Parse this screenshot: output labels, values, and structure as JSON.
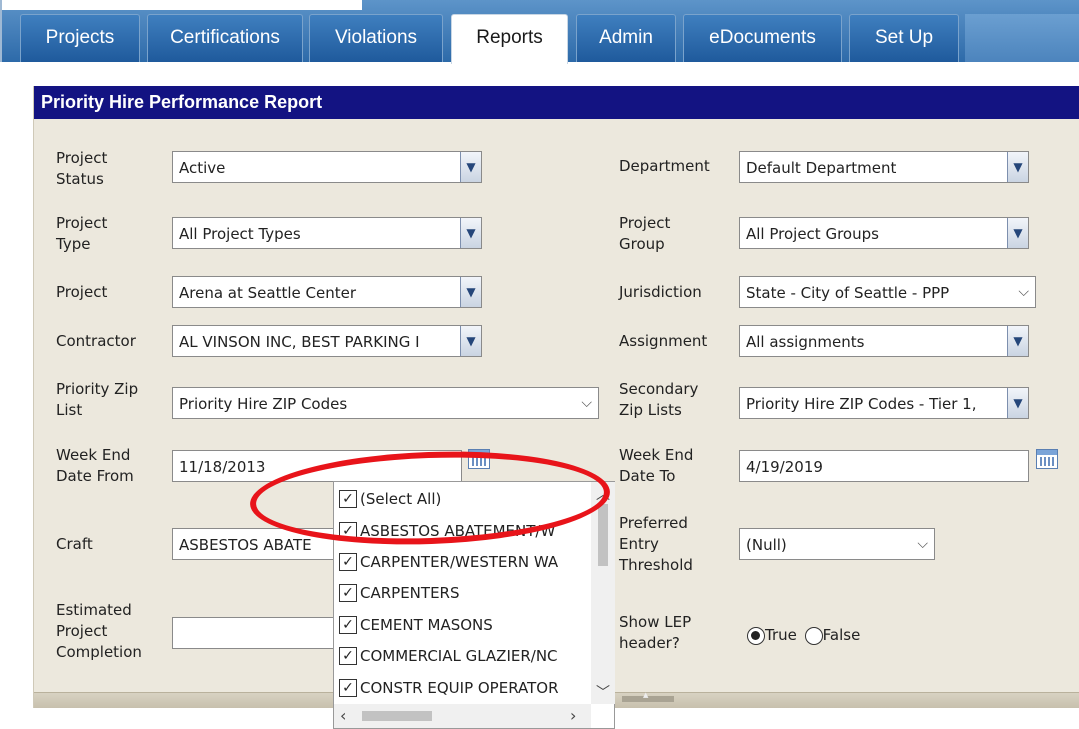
{
  "tabs": [
    {
      "label": "Projects",
      "active": false
    },
    {
      "label": "Certifications",
      "active": false
    },
    {
      "label": "Violations",
      "active": false
    },
    {
      "label": "Reports",
      "active": true
    },
    {
      "label": "Admin",
      "active": false
    },
    {
      "label": "eDocuments",
      "active": false
    },
    {
      "label": "Set Up",
      "active": false
    }
  ],
  "report": {
    "title": "Priority Hire Performance Report",
    "fields": {
      "project_status": {
        "label": "Project Status",
        "value": "Active"
      },
      "project_type": {
        "label": "Project Type",
        "value": "All Project Types"
      },
      "project": {
        "label": "Project",
        "value": "Arena at Seattle Center"
      },
      "contractor": {
        "label": "Contractor",
        "value": "AL VINSON INC, BEST PARKING I"
      },
      "priority_zip_list": {
        "label": "Priority Zip List",
        "value": "Priority Hire ZIP Codes"
      },
      "week_end_from": {
        "label": "Week End Date From",
        "value": "11/18/2013"
      },
      "craft": {
        "label": "Craft",
        "value": "ASBESTOS ABATE"
      },
      "estimated_completion": {
        "label": "Estimated Project Completion",
        "value": ""
      },
      "department": {
        "label": "Department",
        "value": "Default Department"
      },
      "project_group": {
        "label": "Project Group",
        "value": "All Project Groups"
      },
      "jurisdiction": {
        "label": "Jurisdiction",
        "value": "State - City of Seattle - PPP"
      },
      "assignment": {
        "label": "Assignment",
        "value": "All assignments"
      },
      "secondary_zip_lists": {
        "label": "Secondary Zip Lists",
        "value": "Priority Hire ZIP Codes - Tier 1,"
      },
      "week_end_to": {
        "label": "Week End Date To",
        "value": "4/19/2019"
      },
      "preferred_entry_threshold": {
        "label": "Preferred Entry Threshold",
        "value": "(Null)"
      },
      "show_lep_header": {
        "label": "Show LEP header?",
        "true_label": "True",
        "false_label": "False",
        "selected": "True"
      }
    }
  },
  "craft_dropdown": {
    "items": [
      {
        "label": "(Select All)",
        "checked": true
      },
      {
        "label": "ASBESTOS ABATEMENT/W",
        "checked": true
      },
      {
        "label": "CARPENTER/WESTERN WA",
        "checked": true
      },
      {
        "label": "CARPENTERS",
        "checked": true
      },
      {
        "label": "CEMENT MASONS",
        "checked": true
      },
      {
        "label": "COMMERCIAL GLAZIER/NC",
        "checked": true
      },
      {
        "label": "CONSTR EQUIP OPERATOR",
        "checked": true
      }
    ]
  },
  "colors": {
    "title_bar": "#131382",
    "panel_bg": "#ece8dd",
    "tab_bg": "#2d6aa9",
    "highlight_oval": "#e8141a"
  }
}
